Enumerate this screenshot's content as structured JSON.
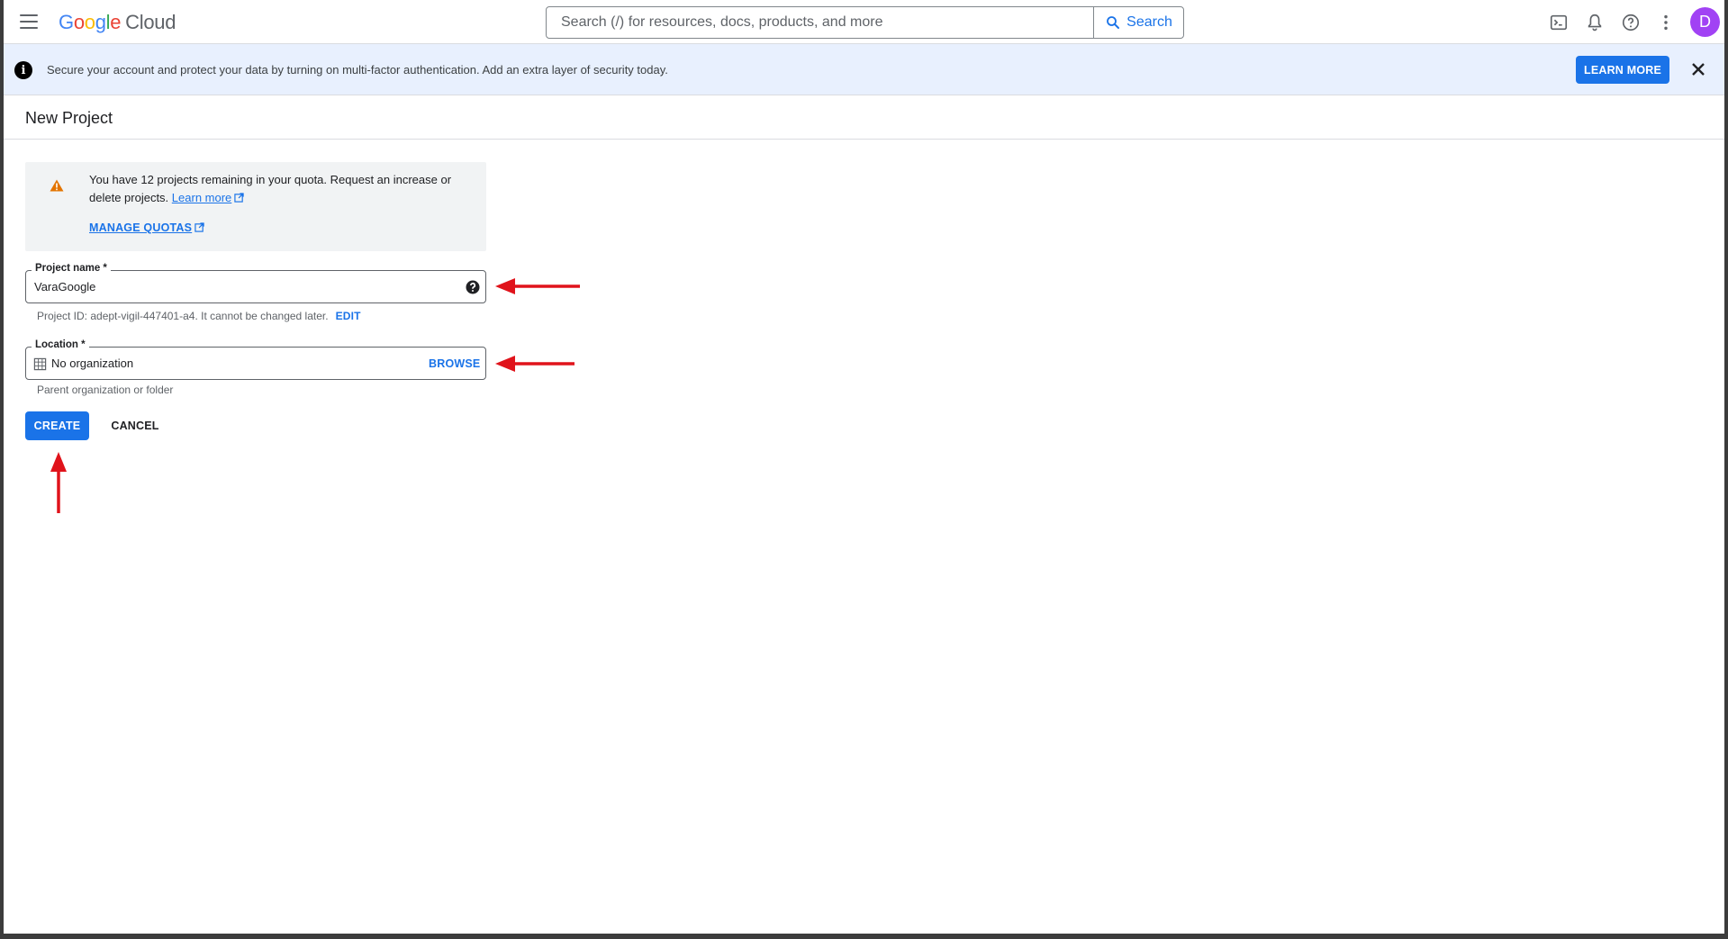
{
  "topbar": {
    "logo": {
      "G": "G",
      "o1": "o",
      "o2": "o",
      "g": "g",
      "l": "l",
      "e": "e",
      "cloud": "Cloud"
    },
    "search": {
      "placeholder": "Search (/) for resources, docs, products, and more",
      "button_label": "Search"
    },
    "icons": [
      "terminal-icon",
      "bell-icon",
      "help-icon",
      "more-vert-icon"
    ],
    "avatar_initial": "D"
  },
  "banner": {
    "text": "Secure your account and protect your data by turning on multi-factor authentication. Add an extra layer of security today.",
    "learn_more_label": "LEARN MORE"
  },
  "page": {
    "title": "New Project"
  },
  "quota": {
    "text": "You have 12 projects remaining in your quota. Request an increase or delete projects.",
    "learn_more": "Learn more",
    "manage_quotas": "MANAGE QUOTAS"
  },
  "form": {
    "project_name": {
      "label": "Project name *",
      "value": "VaraGoogle",
      "helper_prefix": "Project ID: ",
      "project_id": "adept-vigil-447401-a4",
      "helper_suffix": ". It cannot be changed later.",
      "edit_label": "EDIT"
    },
    "location": {
      "label": "Location *",
      "value": "No organization",
      "browse_label": "BROWSE",
      "helper": "Parent organization or folder"
    },
    "create_label": "CREATE",
    "cancel_label": "CANCEL"
  },
  "colors": {
    "primary": "#1a73e8",
    "banner_bg": "#e8f0fe",
    "avatar": "#a142f4",
    "annotation_arrow": "#e0131b",
    "warning": "#e37400"
  }
}
